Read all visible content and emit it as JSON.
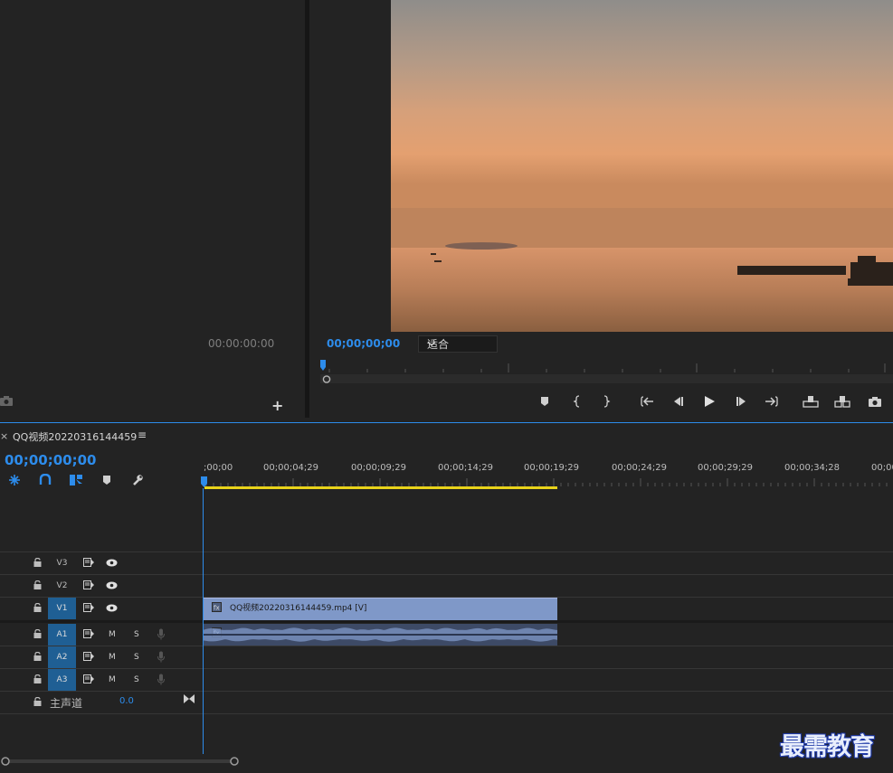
{
  "source_monitor": {
    "timecode": "00:00:00:00"
  },
  "program_monitor": {
    "timecode": "00;00;00;00",
    "fit_option": "适合"
  },
  "timeline": {
    "sequence_name": "QQ视频20220316144459",
    "close_glyph": "×",
    "menu_glyph": "≡",
    "timecode": "00;00;00;00",
    "ruler_labels": [
      ";00;00",
      "00;00;04;29",
      "00;00;09;29",
      "00;00;14;29",
      "00;00;19;29",
      "00;00;24;29",
      "00;00;29;29",
      "00;00;34;28",
      "00;00"
    ],
    "video_tracks": [
      {
        "name": "V3",
        "active": false
      },
      {
        "name": "V2",
        "active": false
      },
      {
        "name": "V1",
        "active": true
      }
    ],
    "audio_tracks": [
      {
        "name": "A1",
        "m": "M",
        "s": "S"
      },
      {
        "name": "A2",
        "m": "M",
        "s": "S"
      },
      {
        "name": "A3",
        "m": "M",
        "s": "S"
      }
    ],
    "master": {
      "label": "主声道",
      "value": "0.0"
    },
    "video_clip_label": "QQ视频20220316144459.mp4 [V]"
  },
  "watermark": "最需教育",
  "colors": {
    "accent": "#2d8ceb",
    "track_active": "#1f5f94",
    "clip_video": "#7f98c8",
    "clip_audio": "#3d4a66",
    "inout_bar": "#e8d21a"
  },
  "icons": {
    "transport": [
      "marker-icon",
      "mark-in-icon",
      "mark-out-icon",
      "go-to-in-icon",
      "step-back-icon",
      "play-icon",
      "step-forward-icon",
      "go-to-out-icon",
      "lift-icon",
      "extract-icon",
      "export-frame-icon"
    ],
    "tools": [
      "snap-nest-icon",
      "snap-icon",
      "linked-selection-icon",
      "add-marker-icon",
      "settings-wrench-icon"
    ]
  }
}
